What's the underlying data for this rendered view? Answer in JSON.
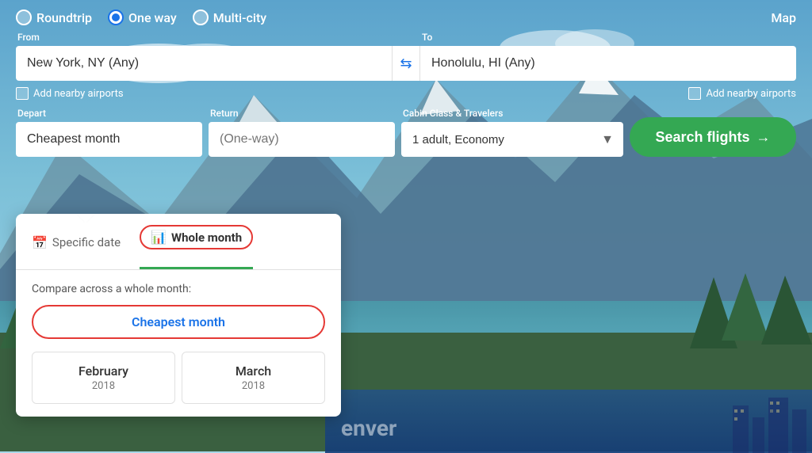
{
  "background": {
    "gradient_desc": "mountain lake scenic"
  },
  "header": {
    "radio_options": [
      {
        "label": "Roundtrip",
        "selected": false,
        "name": "roundtrip-radio"
      },
      {
        "label": "One way",
        "selected": true,
        "name": "oneway-radio"
      },
      {
        "label": "Multi-city",
        "selected": false,
        "name": "multicity-radio"
      }
    ],
    "map_label": "Map"
  },
  "form": {
    "from_label": "From",
    "from_value": "New York, NY (Any)",
    "to_label": "To",
    "to_value": "Honolulu, HI (Any)",
    "swap_icon": "⇆",
    "from_nearby_label": "Add nearby airports",
    "to_nearby_label": "Add nearby airports",
    "depart_label": "Depart",
    "depart_value": "Cheapest month",
    "return_label": "Return",
    "return_placeholder": "(One-way)",
    "cabin_label": "Cabin Class & Travelers",
    "cabin_value": "1 adult, Economy",
    "search_label": "Search flights",
    "search_arrow": "→"
  },
  "dropdown": {
    "specific_date_label": "Specific date",
    "specific_date_icon": "📅",
    "whole_month_label": "Whole month",
    "whole_month_icon": "📊",
    "compare_label": "Compare across a whole month:",
    "cheapest_month_label": "Cheapest month",
    "months": [
      {
        "name": "February",
        "year": "2018"
      },
      {
        "name": "March",
        "year": "2018"
      }
    ]
  },
  "city_overlay": {
    "city_text": "enver"
  }
}
